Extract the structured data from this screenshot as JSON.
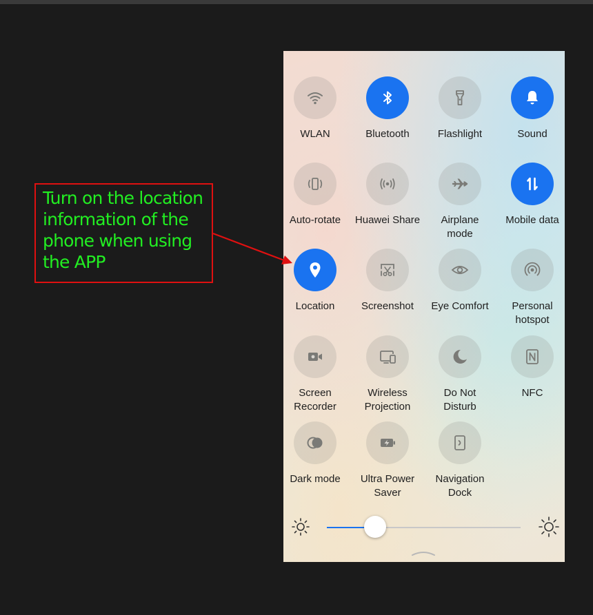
{
  "callout": {
    "text": "Turn on the location information of the phone when using the APP",
    "text_color": "#22ee22",
    "border_color": "#e01010"
  },
  "panel": {
    "accent": "#1a73f0",
    "tiles": [
      {
        "label": "WLAN",
        "icon": "wifi-icon",
        "active": false
      },
      {
        "label": "Bluetooth",
        "icon": "bluetooth-icon",
        "active": true
      },
      {
        "label": "Flashlight",
        "icon": "flashlight-icon",
        "active": false
      },
      {
        "label": "Sound",
        "icon": "bell-icon",
        "active": true
      },
      {
        "label": "Auto-rotate",
        "icon": "auto-rotate-icon",
        "active": false
      },
      {
        "label": "Huawei Share",
        "icon": "huawei-share-icon",
        "active": false
      },
      {
        "label": "Airplane\nmode",
        "icon": "airplane-icon",
        "active": false
      },
      {
        "label": "Mobile data",
        "icon": "mobile-data-icon",
        "active": true
      },
      {
        "label": "Location",
        "icon": "location-pin-icon",
        "active": true
      },
      {
        "label": "Screenshot",
        "icon": "screenshot-icon",
        "active": false
      },
      {
        "label": "Eye Comfort",
        "icon": "eye-icon",
        "active": false
      },
      {
        "label": "Personal\nhotspot",
        "icon": "hotspot-icon",
        "active": false
      },
      {
        "label": "Screen\nRecorder",
        "icon": "video-camera-icon",
        "active": false
      },
      {
        "label": "Wireless\nProjection",
        "icon": "projection-icon",
        "active": false
      },
      {
        "label": "Do Not\nDisturb",
        "icon": "moon-icon",
        "active": false
      },
      {
        "label": "NFC",
        "icon": "nfc-icon",
        "active": false
      },
      {
        "label": "Dark mode",
        "icon": "dark-mode-icon",
        "active": false
      },
      {
        "label": "Ultra Power\nSaver",
        "icon": "battery-bolt-icon",
        "active": false
      },
      {
        "label": "Navigation\nDock",
        "icon": "navigation-dock-icon",
        "active": false
      }
    ]
  },
  "brightness": {
    "level": 0.25,
    "low_icon": "sun-low-icon",
    "high_icon": "sun-high-icon"
  }
}
